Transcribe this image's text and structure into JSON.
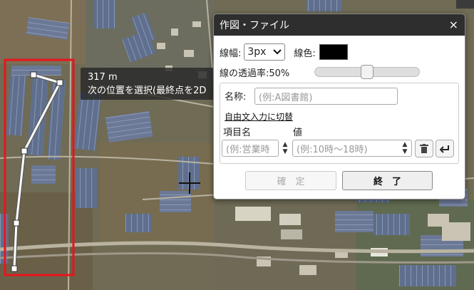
{
  "tooltip": {
    "distance": "317 m",
    "instruction": "次の位置を選択(最終点を2D"
  },
  "dialog": {
    "title": "作図・ファイル",
    "close_label": "×",
    "line_width_label": "線幅:",
    "line_width_value": "3px",
    "line_color_label": "線色:",
    "line_color": "#000000",
    "opacity_label": "線の透過率:50%",
    "opacity_value": 0.5,
    "name_label": "名称:",
    "name_placeholder": "(例:A図書館)",
    "free_text_link": "自由文入力に切替",
    "item_name_header": "項目名",
    "value_header": "値",
    "item_placeholder": "(例:営業時",
    "value_placeholder": "(例:10時〜18時)",
    "confirm_label": "確　定",
    "finish_label": "終　了"
  },
  "colors": {
    "route_line": "#ffffff",
    "selection_box": "#e8141c",
    "dialog_header": "#2e2e2e"
  }
}
